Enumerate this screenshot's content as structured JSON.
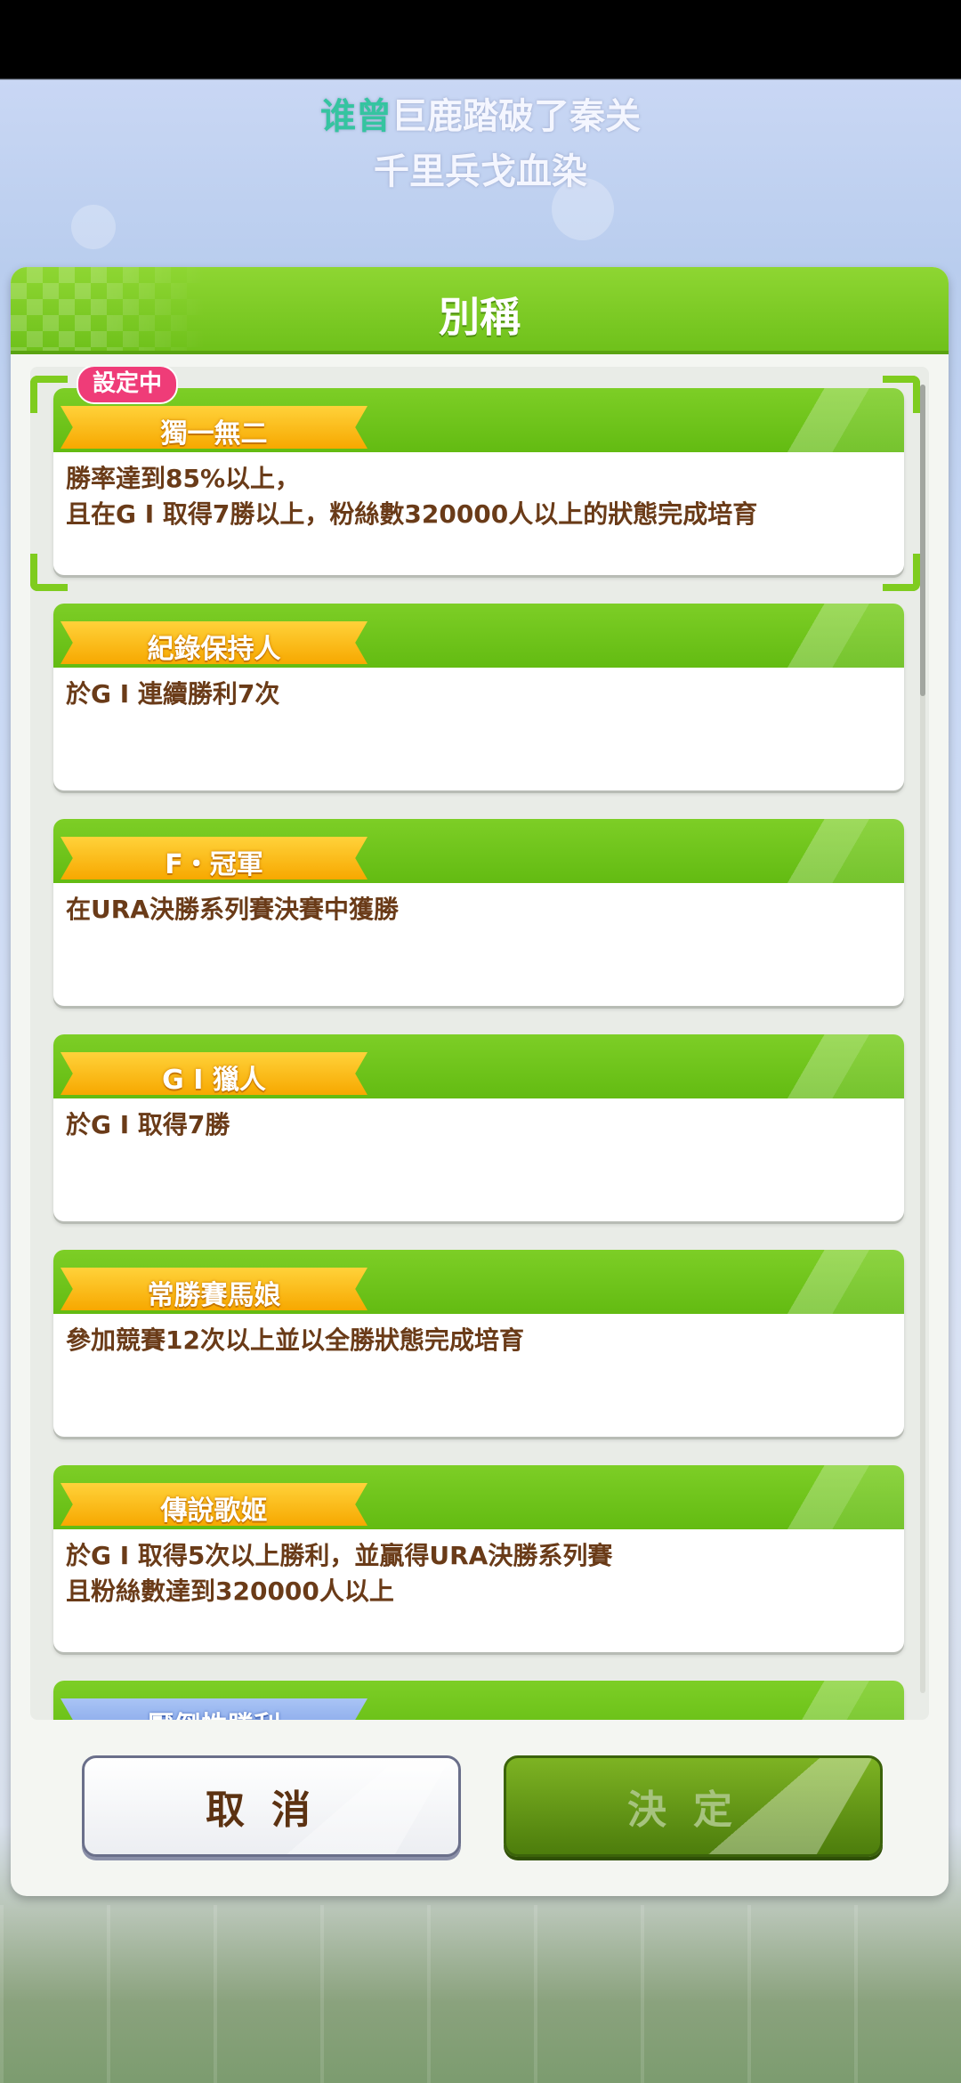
{
  "lyrics": {
    "line1_highlight": "谁曾",
    "line1_rest": "巨鹿踏破了秦关",
    "line2": "千里兵戈血染"
  },
  "panel": {
    "title": "別稱"
  },
  "titles": [
    {
      "name": "獨一無二",
      "description": "勝率達到85%以上，\n且在G I 取得7勝以上，粉絲數320000人以上的狀態完成培育",
      "badge": "設定中"
    },
    {
      "name": "紀錄保持人",
      "description": "於G I 連續勝利7次"
    },
    {
      "name": "F・冠軍",
      "description": "在URA決勝系列賽決賽中獲勝"
    },
    {
      "name": "G I 獵人",
      "description": "於G I 取得7勝"
    },
    {
      "name": "常勝賽馬娘",
      "description": "參加競賽12次以上並以全勝狀態完成培育"
    },
    {
      "name": "傳說歌姬",
      "description": "於G I 取得5次以上勝利，並贏得URA決勝系列賽\n且粉絲數達到320000人以上"
    },
    {
      "name": "壓倒性勝利",
      "description": ""
    }
  ],
  "buttons": {
    "cancel": "取消",
    "confirm": "決定"
  },
  "colors": {
    "accent_green": "#6fc11b",
    "ribbon_gold": "#f7a800",
    "badge_pink": "#ef3c78",
    "text_brown": "#6a3b18"
  }
}
